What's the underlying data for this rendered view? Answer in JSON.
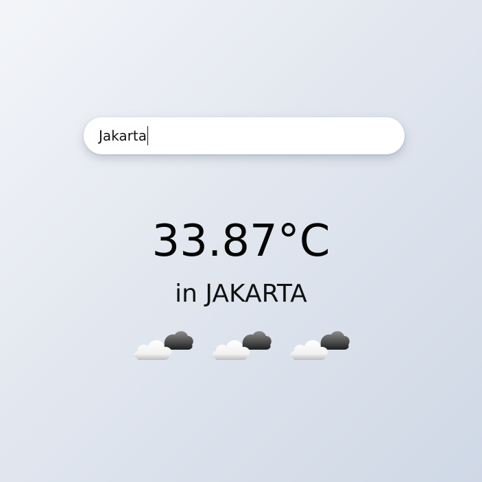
{
  "search": {
    "value": "Jakarta",
    "placeholder": ""
  },
  "weather": {
    "temperature": "33.87°C",
    "location_line": "in JAKARTA",
    "icons": [
      "cloud-sun-icon",
      "cloud-sun-icon",
      "cloud-sun-icon"
    ]
  },
  "colors": {
    "background_start": "#f3f5f9",
    "background_end": "#cfd8e6",
    "text": "#050505",
    "input_bg": "#ffffff"
  }
}
